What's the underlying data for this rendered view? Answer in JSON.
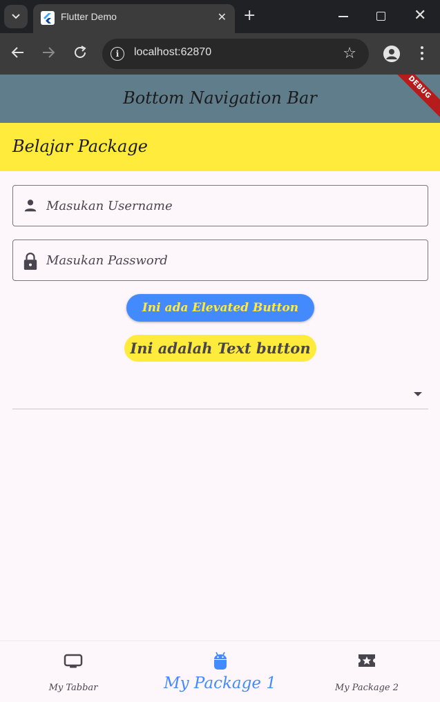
{
  "browser": {
    "tab_title": "Flutter Demo",
    "url": "localhost:62870"
  },
  "appbar": {
    "title": "Bottom Navigation Bar",
    "debug_banner": "DEBUG"
  },
  "section": {
    "title": "Belajar Package"
  },
  "form": {
    "username_placeholder": "Masukan Username",
    "password_placeholder": "Masukan Password",
    "elevated_button_label": "Ini ada Elevated Button",
    "text_button_label": "Ini adalah Text button",
    "dropdown_value": ""
  },
  "bottom_nav": {
    "items": [
      {
        "label": "My Tabbar",
        "icon": "tv-icon",
        "selected": false
      },
      {
        "label": "My Package 1",
        "icon": "android-icon",
        "selected": true
      },
      {
        "label": "My Package 2",
        "icon": "ticket-star-icon",
        "selected": false
      }
    ]
  },
  "colors": {
    "appbar": "#607d8b",
    "section_bar": "#ffeb3b",
    "primary_blue": "#448aff",
    "selected_nav": "#448aff"
  }
}
